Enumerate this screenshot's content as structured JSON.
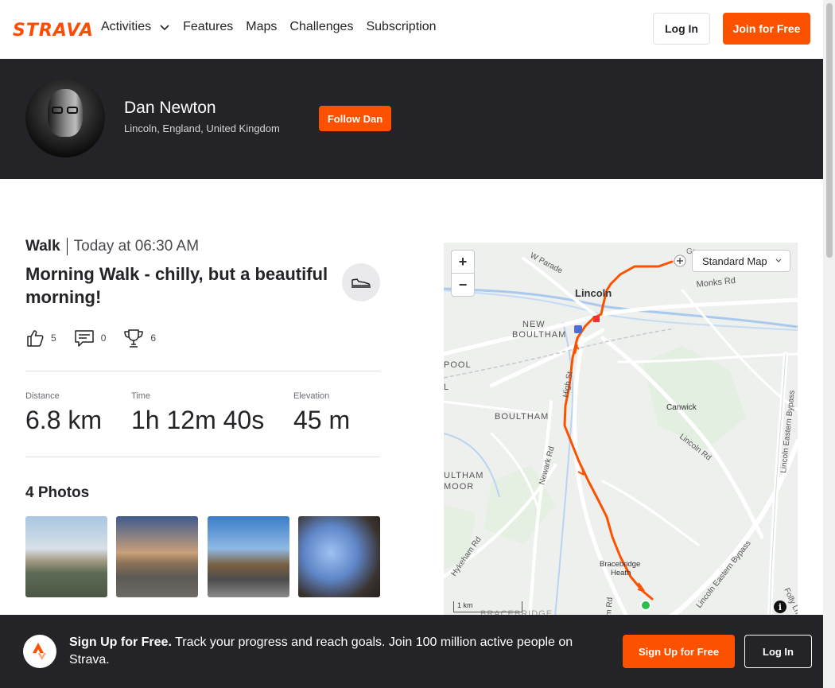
{
  "header": {
    "logo": "STRAVA",
    "nav": [
      {
        "label": "Activities"
      },
      {
        "label": "Features"
      },
      {
        "label": "Maps"
      },
      {
        "label": "Challenges"
      },
      {
        "label": "Subscription"
      }
    ],
    "login_label": "Log In",
    "join_label": "Join for Free"
  },
  "athlete": {
    "name": "Dan Newton",
    "location": "Lincoln, England, United Kingdom",
    "follow_label": "Follow Dan"
  },
  "activity": {
    "type": "Walk",
    "time": "Today at 06:30 AM",
    "title": "Morning Walk - chilly, but a beautiful morning!",
    "kudos": "5",
    "comments": "0",
    "achievements": "6",
    "stats": [
      {
        "label": "Distance",
        "value": "6.8 km"
      },
      {
        "label": "Time",
        "value": "1h 12m 40s"
      },
      {
        "label": "Elevation",
        "value": "45 m"
      }
    ],
    "photos_title": "4 Photos"
  },
  "map": {
    "map_type": "Standard Map",
    "scale_label": "1 km",
    "labels": {
      "w_parade": "W Parade",
      "lincoln": "Lincoln",
      "monks_rd": "Monks Rd",
      "new_boultham_1": "NEW",
      "new_boultham_2": "BOULTHAM",
      "pool": "POOL",
      "l": "L",
      "high_st": "High St",
      "boultham": "BOULTHAM",
      "canwick": "Canwick",
      "lincoln_rd": "Lincoln Rd",
      "newark_rd": "Newark Rd",
      "ultham_moor_1": "ULTHAM",
      "ultham_moor_2": "MOOR",
      "hykeham_rd": "Hykeham Rd",
      "bracebridge_1": "Bracebridge",
      "bracebridge_2": "Heath",
      "bracebridge_caps": "BRACEBRIDGE",
      "m_rd": "m Rd",
      "eastern_bypass_1": "Lincoln Eastern Bypass",
      "eastern_bypass_2": "Lincoln Eastern Bypass",
      "folly_ln": "Folly Ln",
      "gr": "Gr"
    },
    "route_color": "#fc5200"
  },
  "signup_banner": {
    "bold": "Sign Up for Free.",
    "text": " Track your progress and reach goals. Join 100 million active people on Strava.",
    "signup_label": "Sign Up for Free",
    "login_label": "Log In"
  },
  "colors": {
    "brand": "#fc5200",
    "dark": "#242428"
  }
}
